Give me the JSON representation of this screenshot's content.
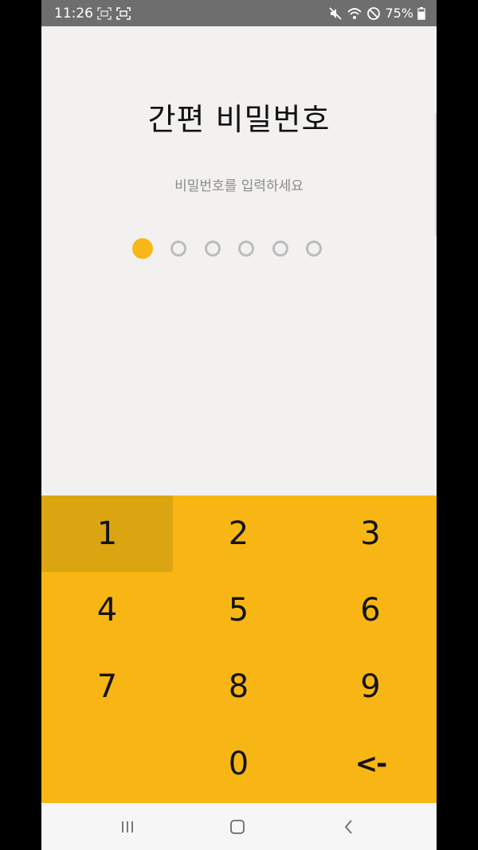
{
  "status_bar": {
    "time": "11:26",
    "battery": "75%",
    "left_icons": [
      "screenshot-icon",
      "screen-record-icon"
    ],
    "right_icons": [
      "mute-icon",
      "wifi-icon",
      "do-not-disturb-icon",
      "battery-icon"
    ]
  },
  "header": {
    "title": "간편 비밀번호",
    "subtitle": "비밀번호를 입력하세요"
  },
  "pin": {
    "length": 6,
    "entered": 1,
    "filled_color": "#f8b619",
    "empty_color": "#bcbcbc"
  },
  "keypad": {
    "background": "#f8b614",
    "pressed_key": "1",
    "keys": [
      {
        "label": "1",
        "name": "key-1"
      },
      {
        "label": "2",
        "name": "key-2"
      },
      {
        "label": "3",
        "name": "key-3"
      },
      {
        "label": "4",
        "name": "key-4"
      },
      {
        "label": "5",
        "name": "key-5"
      },
      {
        "label": "6",
        "name": "key-6"
      },
      {
        "label": "7",
        "name": "key-7"
      },
      {
        "label": "8",
        "name": "key-8"
      },
      {
        "label": "9",
        "name": "key-9"
      },
      {
        "label": "",
        "name": "key-empty"
      },
      {
        "label": "0",
        "name": "key-0"
      },
      {
        "label": "<-",
        "name": "key-backspace"
      }
    ]
  },
  "nav_bar": {
    "buttons": [
      "recent-apps-icon",
      "home-icon",
      "back-icon"
    ]
  }
}
